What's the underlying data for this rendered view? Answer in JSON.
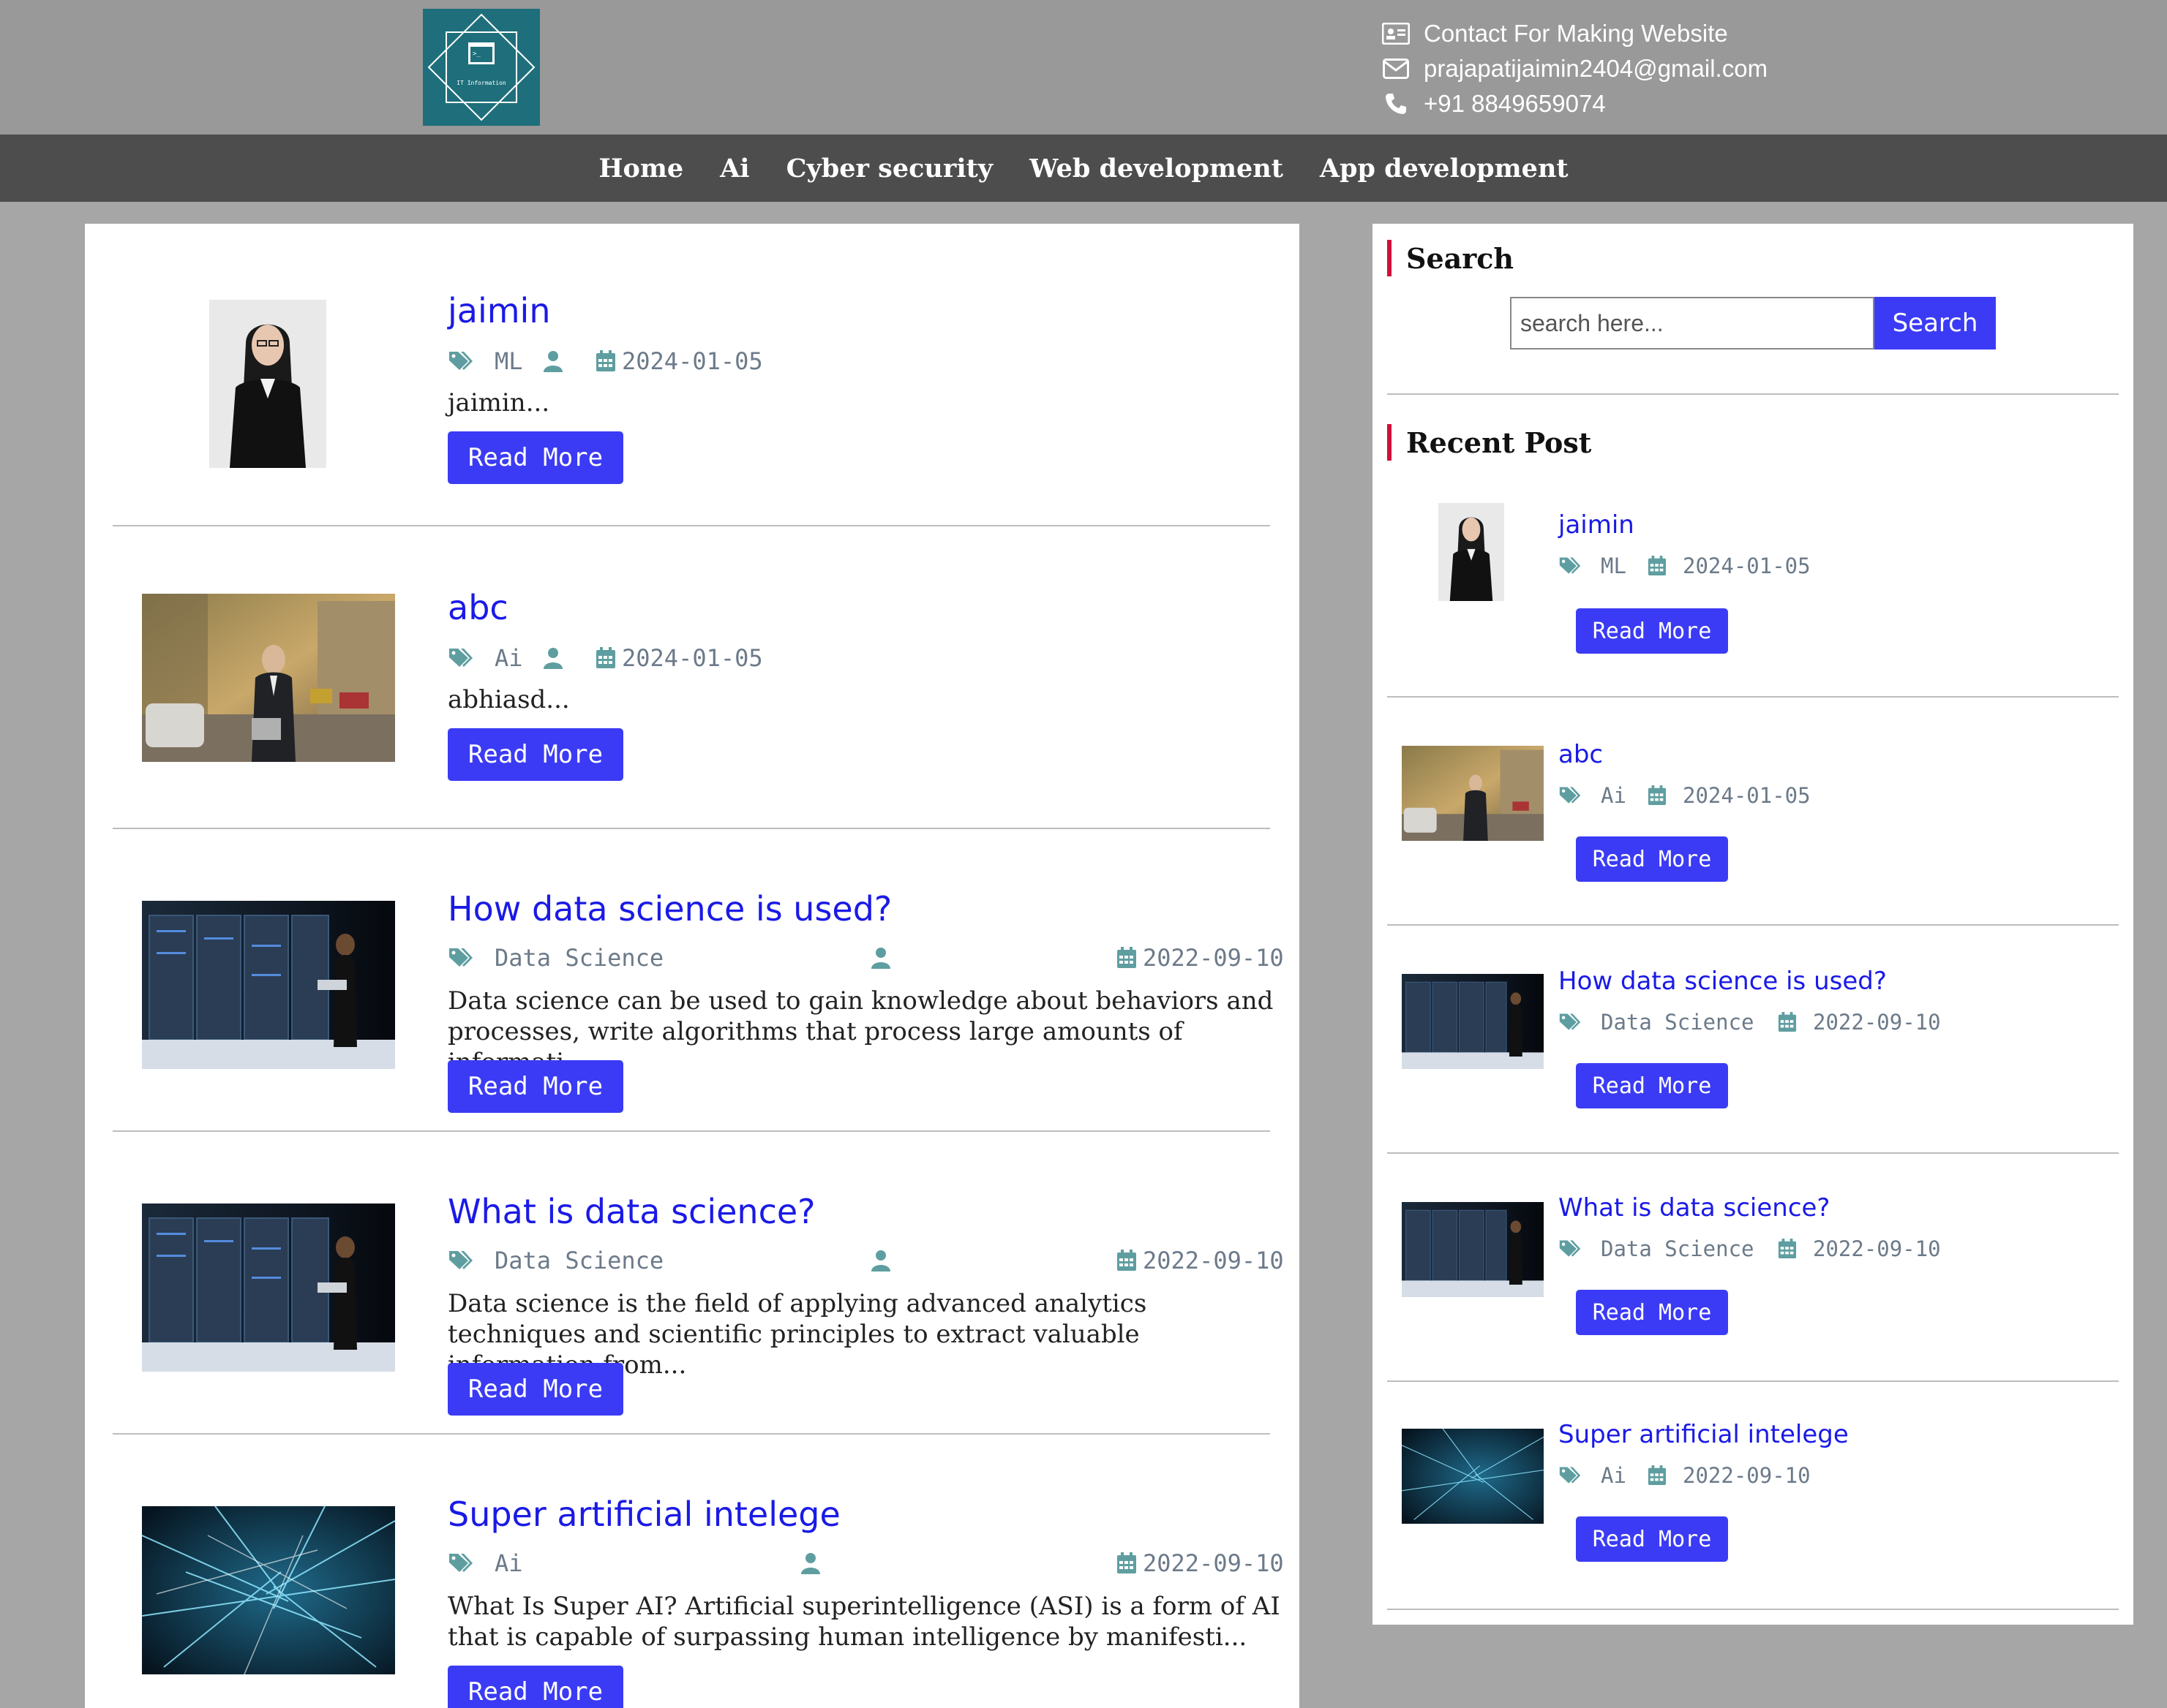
{
  "header": {
    "logo_text": "IT Information",
    "contact": [
      {
        "icon": "id-card-icon",
        "text": "Contact For Making Website"
      },
      {
        "icon": "envelope-icon",
        "text": "prajapatijaimin2404@gmail.com"
      },
      {
        "icon": "phone-icon",
        "text": "+91 8849659074"
      }
    ]
  },
  "nav": {
    "items": [
      {
        "label": "Home"
      },
      {
        "label": "Ai"
      },
      {
        "label": "Cyber security"
      },
      {
        "label": "Web development"
      },
      {
        "label": "App development"
      }
    ]
  },
  "posts": [
    {
      "title": "jaimin",
      "category": "ML",
      "date": "2024-01-05",
      "excerpt": "jaimin...",
      "read_more": "Read More",
      "thumb": "portrait"
    },
    {
      "title": "abc",
      "category": "Ai",
      "date": "2024-01-05",
      "excerpt": "abhiasd...",
      "read_more": "Read More",
      "thumb": "street"
    },
    {
      "title": "How data science is used?",
      "category": "Data Science",
      "date": "2022-09-10",
      "excerpt": "Data science can be used to gain knowledge about behaviors and processes, write algorithms that process large amounts of informati...",
      "read_more": "Read More",
      "thumb": "servers"
    },
    {
      "title": "What is data science?",
      "category": "Data Science",
      "date": "2022-09-10",
      "excerpt": "Data science is the field of applying advanced analytics techniques and scientific principles to extract valuable information from...",
      "read_more": "Read More",
      "thumb": "servers"
    },
    {
      "title": "Super artificial intelege",
      "category": "Ai",
      "date": "2022-09-10",
      "excerpt": "What Is Super AI? Artificial superintelligence (ASI) is a form of AI that is capable of surpassing human intelligence by manifesti...",
      "read_more": "Read More",
      "thumb": "network"
    }
  ],
  "sidebar": {
    "search_heading": "Search",
    "search_placeholder": "search here...",
    "search_button": "Search",
    "recent_heading": "Recent Post",
    "recent": [
      {
        "title": "jaimin",
        "category": "ML",
        "date": "2024-01-05",
        "read_more": "Read More"
      },
      {
        "title": "abc",
        "category": "Ai",
        "date": "2024-01-05",
        "read_more": "Read More"
      },
      {
        "title": "How data science is used?",
        "category": "Data Science",
        "date": "2022-09-10",
        "read_more": "Read More"
      },
      {
        "title": "What is data science?",
        "category": "Data Science",
        "date": "2022-09-10",
        "read_more": "Read More"
      },
      {
        "title": "Super artificial intelege",
        "category": "Ai",
        "date": "2022-09-10",
        "read_more": "Read More"
      }
    ]
  },
  "colors": {
    "header_bg": "#999999",
    "nav_bg": "#4d4d4d",
    "page_bg": "#a6a6a6",
    "link_blue": "#1a1ae6",
    "button_blue": "#3b3bf5",
    "heading_accent": "#d0103a",
    "icon_teal": "#5f9ea0"
  }
}
